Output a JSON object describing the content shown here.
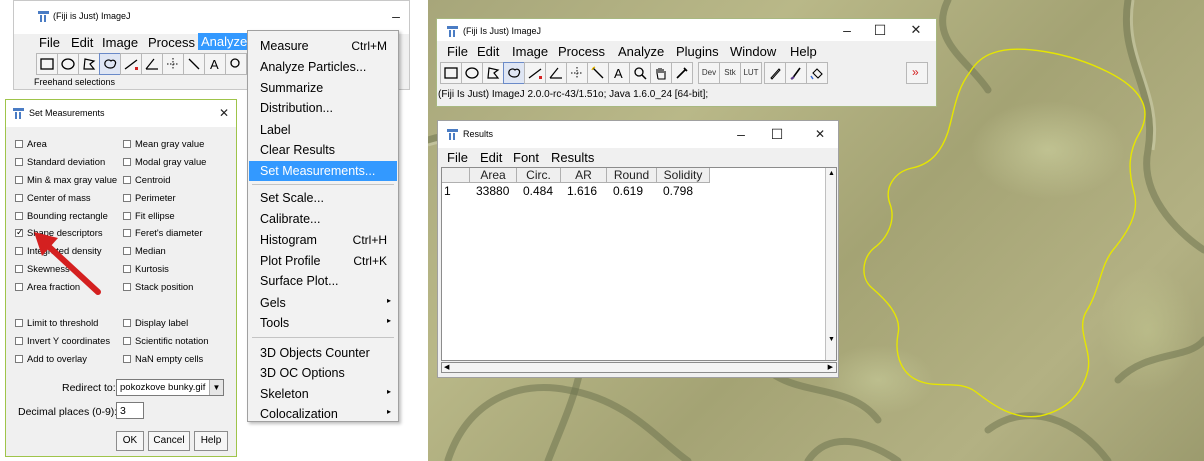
{
  "left_imagej": {
    "title": "(Fiji is Just) ImageJ",
    "minimize": "–",
    "menu": [
      "File",
      "Edit",
      "Image",
      "Process",
      "Analyze"
    ],
    "status": "Freehand selections"
  },
  "analyze_menu": {
    "items": [
      {
        "label": "Measure",
        "shortcut": "Ctrl+M"
      },
      {
        "label": "Analyze Particles..."
      },
      {
        "label": "Summarize"
      },
      {
        "label": "Distribution..."
      },
      {
        "label": "Label"
      },
      {
        "label": "Clear Results"
      },
      {
        "label": "Set Measurements..."
      },
      {
        "label": "Set Scale..."
      },
      {
        "label": "Calibrate..."
      },
      {
        "label": "Histogram",
        "shortcut": "Ctrl+H"
      },
      {
        "label": "Plot Profile",
        "shortcut": "Ctrl+K"
      },
      {
        "label": "Surface Plot..."
      },
      {
        "label": "Gels"
      },
      {
        "label": "Tools"
      },
      {
        "label": "3D Objects Counter"
      },
      {
        "label": "3D OC Options"
      },
      {
        "label": "Skeleton"
      },
      {
        "label": "Colocalization"
      }
    ],
    "submenu_arrow": "▸"
  },
  "set_measurements": {
    "title": "Set Measurements",
    "close": "✕",
    "options": [
      {
        "label": "Area",
        "checked": false
      },
      {
        "label": "Mean gray value",
        "checked": false
      },
      {
        "label": "Standard deviation",
        "checked": false
      },
      {
        "label": "Modal gray value",
        "checked": false
      },
      {
        "label": "Min & max gray value",
        "checked": false
      },
      {
        "label": "Centroid",
        "checked": false
      },
      {
        "label": "Center of mass",
        "checked": false
      },
      {
        "label": "Perimeter",
        "checked": false
      },
      {
        "label": "Bounding rectangle",
        "checked": false
      },
      {
        "label": "Fit ellipse",
        "checked": false
      },
      {
        "label": "Shape descriptors",
        "checked": true
      },
      {
        "label": "Feret's diameter",
        "checked": false
      },
      {
        "label": "Integrated density",
        "checked": false
      },
      {
        "label": "Median",
        "checked": false
      },
      {
        "label": "Skewness",
        "checked": false
      },
      {
        "label": "Kurtosis",
        "checked": false
      },
      {
        "label": "Area fraction",
        "checked": false
      },
      {
        "label": "Stack position",
        "checked": false
      },
      {
        "label": "Limit to threshold",
        "checked": false
      },
      {
        "label": "Display label",
        "checked": false
      },
      {
        "label": "Invert Y coordinates",
        "checked": false
      },
      {
        "label": "Scientific notation",
        "checked": false
      },
      {
        "label": "Add to overlay",
        "checked": false
      },
      {
        "label": "NaN empty cells",
        "checked": false
      }
    ],
    "redirect_label": "Redirect to:",
    "redirect_value": "pokozkove bunky.gif",
    "decimal_label": "Decimal places (0-9):",
    "decimal_value": "3",
    "ok": "OK",
    "cancel": "Cancel",
    "help": "Help"
  },
  "right_imagej": {
    "title": "(Fiji Is Just) ImageJ",
    "minimize": "–",
    "maximize": "☐",
    "close": "✕",
    "menu": [
      "File",
      "Edit",
      "Image",
      "Process",
      "Analyze",
      "Plugins",
      "Window",
      "Help"
    ],
    "tool_dev": "Dev",
    "tool_stk": "Stk",
    "tool_lut": "LUT",
    "more": "»",
    "status": "(Fiji Is Just) ImageJ 2.0.0-rc-43/1.51o; Java 1.6.0_24 [64-bit];"
  },
  "results": {
    "title": "Results",
    "minimize": "–",
    "maximize": "☐",
    "close": "✕",
    "menu": [
      "File",
      "Edit",
      "Font",
      "Results"
    ],
    "columns": [
      "Area",
      "Circ.",
      "AR",
      "Round",
      "Solidity"
    ],
    "rows": [
      {
        "index": "1",
        "values": [
          "33880",
          "0.484",
          "1.616",
          "0.619",
          "0.798"
        ]
      }
    ]
  },
  "colors": {
    "menu_highlight": "#3399ff",
    "roi_outline": "#e6e600",
    "annotation_arrow": "#d42020"
  }
}
